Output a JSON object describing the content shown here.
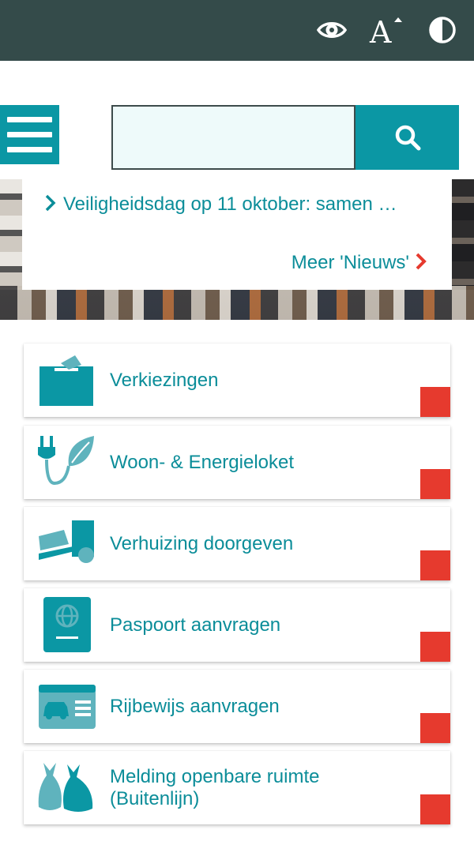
{
  "colors": {
    "topbar": "#344b4a",
    "accent": "#0b97a4",
    "link": "#0b8d99",
    "corner": "#e63a2e"
  },
  "toolbar": {
    "icons": [
      "eye-icon",
      "font-size-icon",
      "contrast-icon"
    ]
  },
  "search": {
    "value": "",
    "placeholder": ""
  },
  "news": {
    "item": "Veiligheidsdag op 11 oktober: samen …",
    "more": "Meer 'Nieuws'"
  },
  "tiles": [
    {
      "label": "Verkiezingen",
      "icon": "ballot-box-icon"
    },
    {
      "label": "Woon- & Energieloket",
      "icon": "plug-leaf-icon"
    },
    {
      "label": "Verhuizing doorgeven",
      "icon": "moving-truck-icon"
    },
    {
      "label": "Paspoort aanvragen",
      "icon": "passport-icon"
    },
    {
      "label": "Rijbewijs aanvragen",
      "icon": "drivers-license-icon"
    },
    {
      "label": "Melding openbare ruimte (Buitenlijn)",
      "icon": "garbage-bags-icon"
    }
  ]
}
